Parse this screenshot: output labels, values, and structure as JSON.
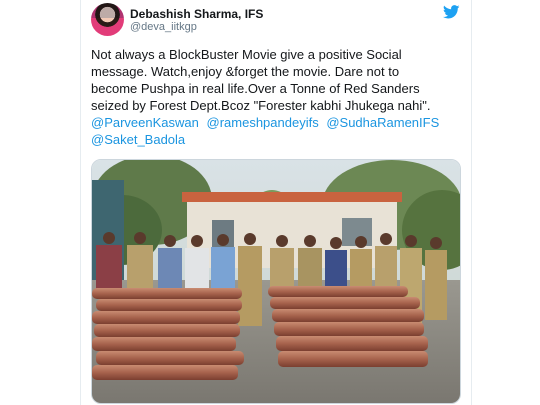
{
  "tweet": {
    "author_name": "Debashish Sharma, IFS",
    "author_handle": "@deva_iitkgp",
    "text_lines": [
      "Not always a BlockBuster Movie give a positive Social",
      "message. Watch,enjoy &forget the movie. Dare not to",
      "become Pushpa in real life.Over a Tonne of Red Sanders",
      "seized by Forest Dept.Bcoz \"Forester kabhi Jhukega nahi\"."
    ],
    "mentions_line1": [
      "@ParveenKaswan",
      "@rameshpandeyifs",
      "@SudhaRamenIFS"
    ],
    "mentions_line2": [
      "@Saket_Badola"
    ],
    "media_alt": "photo",
    "icons": {
      "platform": "twitter-bird-icon"
    },
    "colors": {
      "link": "#1b95e0",
      "twitter_blue": "#1da1f2",
      "text": "#14171a",
      "secondary": "#657786"
    }
  }
}
